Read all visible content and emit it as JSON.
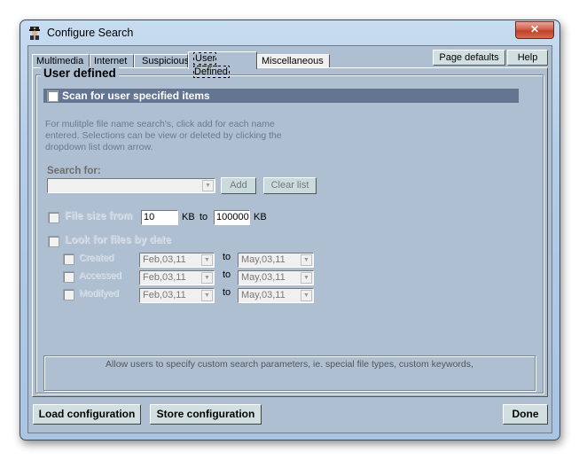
{
  "window": {
    "title": "Configure Search",
    "icon": "police-officer-icon",
    "close_glyph": "✕"
  },
  "tabs": [
    {
      "label": "Multimedia",
      "active": false
    },
    {
      "label": "Internet",
      "active": false
    },
    {
      "label": "Suspicious",
      "active": false
    },
    {
      "label": "User Defined",
      "active": true
    },
    {
      "label": "Miscellaneous",
      "active": false
    }
  ],
  "top_buttons": {
    "page_defaults": "Page defaults",
    "help": "Help"
  },
  "group": {
    "title": "User defined",
    "scan_checkbox": {
      "label": "Scan for user specified items",
      "checked": false
    },
    "info_text": "For mulitple file name search's, click add for each name entered. Selections can be view or deleted by clicking the dropdown list down arrow.",
    "search_for": {
      "label": "Search for:",
      "value": "",
      "add_label": "Add",
      "clear_label": "Clear list"
    },
    "file_size": {
      "label": "File size from",
      "checked": false,
      "from_value": "10",
      "from_unit": "KB",
      "to_label": "to",
      "to_value": "100000",
      "to_unit": "KB"
    },
    "by_date": {
      "label": "Look for files by date",
      "checked": false,
      "rows": [
        {
          "label": "Created",
          "checked": false,
          "from": "Feb,03,11",
          "to_label": "to",
          "to": "May,03,11"
        },
        {
          "label": "Accessed",
          "checked": false,
          "from": "Feb,03,11",
          "to_label": "to",
          "to": "May,03,11"
        },
        {
          "label": "Modifyed",
          "checked": false,
          "from": "Feb,03,11",
          "to_label": "to",
          "to": "May,03,11"
        }
      ]
    },
    "description": "Allow users to specify custom search parameters, ie. special file types, custom keywords,"
  },
  "bottom_buttons": {
    "load": "Load configuration",
    "store": "Store configuration",
    "done": "Done"
  },
  "colors": {
    "dialog_bg": "#aebfd2",
    "scan_bar": "#637591",
    "close_button": "#c9503a"
  }
}
